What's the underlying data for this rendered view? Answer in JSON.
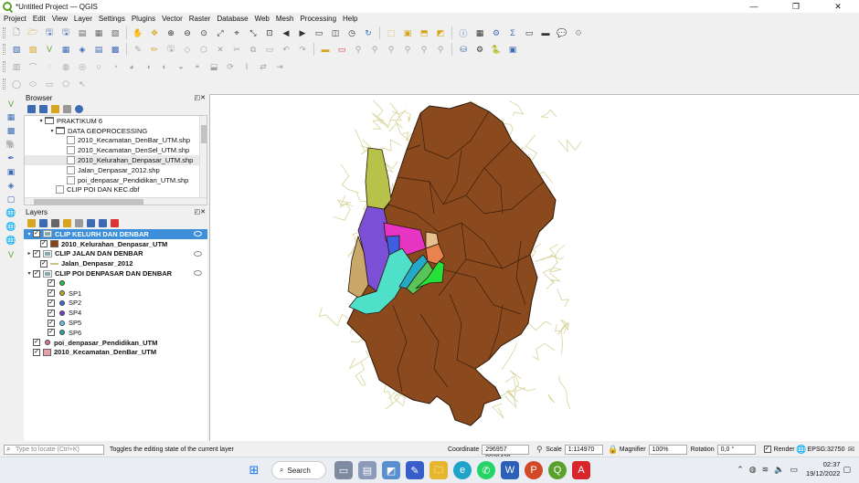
{
  "window": {
    "title": "*Untitled Project — QGIS",
    "minimize": "—",
    "maximize": "❐",
    "close": "✕"
  },
  "menu": [
    "Project",
    "Edit",
    "View",
    "Layer",
    "Settings",
    "Plugins",
    "Vector",
    "Raster",
    "Database",
    "Web",
    "Mesh",
    "Processing",
    "Help"
  ],
  "browser": {
    "title": "Browser",
    "items": [
      {
        "label": "PRAKTIKUM 6",
        "type": "folder",
        "indent": 1,
        "expanded": true
      },
      {
        "label": "DATA GEOPROCESSING",
        "type": "folder",
        "indent": 2,
        "expanded": true
      },
      {
        "label": "2010_Kecamatan_DenBar_UTM.shp",
        "type": "file",
        "indent": 3
      },
      {
        "label": "2010_Kecamatan_DenSel_UTM.shp",
        "type": "file",
        "indent": 3
      },
      {
        "label": "2010_Kelurahan_Denpasar_UTM.shp",
        "type": "file",
        "indent": 3
      },
      {
        "label": "Jalan_Denpasar_2012.shp",
        "type": "file",
        "indent": 3
      },
      {
        "label": "poi_denpasar_Pendidikan_UTM.shp",
        "type": "file",
        "indent": 3
      },
      {
        "label": "CLIP POI DAN KEC.dbf",
        "type": "file",
        "indent": 2
      }
    ]
  },
  "layers": {
    "title": "Layers",
    "items": [
      {
        "label": "CLIP KELURH DAN DENBAR",
        "kind": "group",
        "indent": 0,
        "checked": true,
        "selected": true,
        "bold": true,
        "arrow": "▾"
      },
      {
        "label": "2010_Kelurahan_Denpasar_UTM",
        "kind": "poly",
        "color": "#8b4513",
        "indent": 1,
        "checked": true,
        "bold": true
      },
      {
        "label": "CLIP JALAN DAN DENBAR",
        "kind": "line-group",
        "indent": 0,
        "checked": true,
        "bold": true,
        "arrow": "▸"
      },
      {
        "label": "Jalan_Denpasar_2012",
        "kind": "line",
        "indent": 1,
        "checked": true,
        "bold": true
      },
      {
        "label": "CLIP POI DENPASAR DAN DENBAR",
        "kind": "point-group",
        "indent": 0,
        "checked": true,
        "bold": true,
        "arrow": "▾"
      },
      {
        "label": "",
        "kind": "point",
        "color": "#2bbd4e",
        "indent": 2,
        "checked": true
      },
      {
        "label": "SP1",
        "kind": "point",
        "color": "#c9a227",
        "indent": 2,
        "checked": true
      },
      {
        "label": "SP2",
        "kind": "point",
        "color": "#3c6ad6",
        "indent": 2,
        "checked": true
      },
      {
        "label": "SP4",
        "kind": "point",
        "color": "#7a3fc4",
        "indent": 2,
        "checked": true
      },
      {
        "label": "SP5",
        "kind": "point",
        "color": "#6cc5e8",
        "indent": 2,
        "checked": true
      },
      {
        "label": "SP6",
        "kind": "point",
        "color": "#2aa59a",
        "indent": 2,
        "checked": true
      },
      {
        "label": "poi_denpasar_Pendidikan_UTM",
        "kind": "point",
        "color": "#e0709a",
        "indent": 0,
        "checked": true,
        "bold": true
      },
      {
        "label": "2010_Kecamatan_DenBar_UTM",
        "kind": "poly",
        "color": "#e8a0a8",
        "indent": 0,
        "checked": true,
        "bold": true
      }
    ]
  },
  "map_colors": {
    "kelurahan_fill": "#8b4a1e",
    "road_color": "#d6d49a",
    "zones": [
      "#b7c24a",
      "#7b4fd6",
      "#c9a86a",
      "#e635c2",
      "#3b5fe0",
      "#4ee0c9",
      "#25a9c9",
      "#59c45a",
      "#26e03a",
      "#e88350",
      "#e6c08e"
    ]
  },
  "status": {
    "locate_placeholder": "Type to locate (Ctrl+K)",
    "message": "Toggles the editing state of the current layer",
    "coordinate_label": "Coordinate",
    "coordinate": "296957 9038420",
    "scale_label": "Scale",
    "scale": "1:114970",
    "magnifier_label": "Magnifier",
    "magnifier": "100%",
    "rotation_label": "Rotation",
    "rotation": "0,0 °",
    "render_label": "Render",
    "crs": "EPSG:32750"
  },
  "taskbar": {
    "search_label": "Search",
    "time": "02:37",
    "date": "19/12/2022"
  }
}
